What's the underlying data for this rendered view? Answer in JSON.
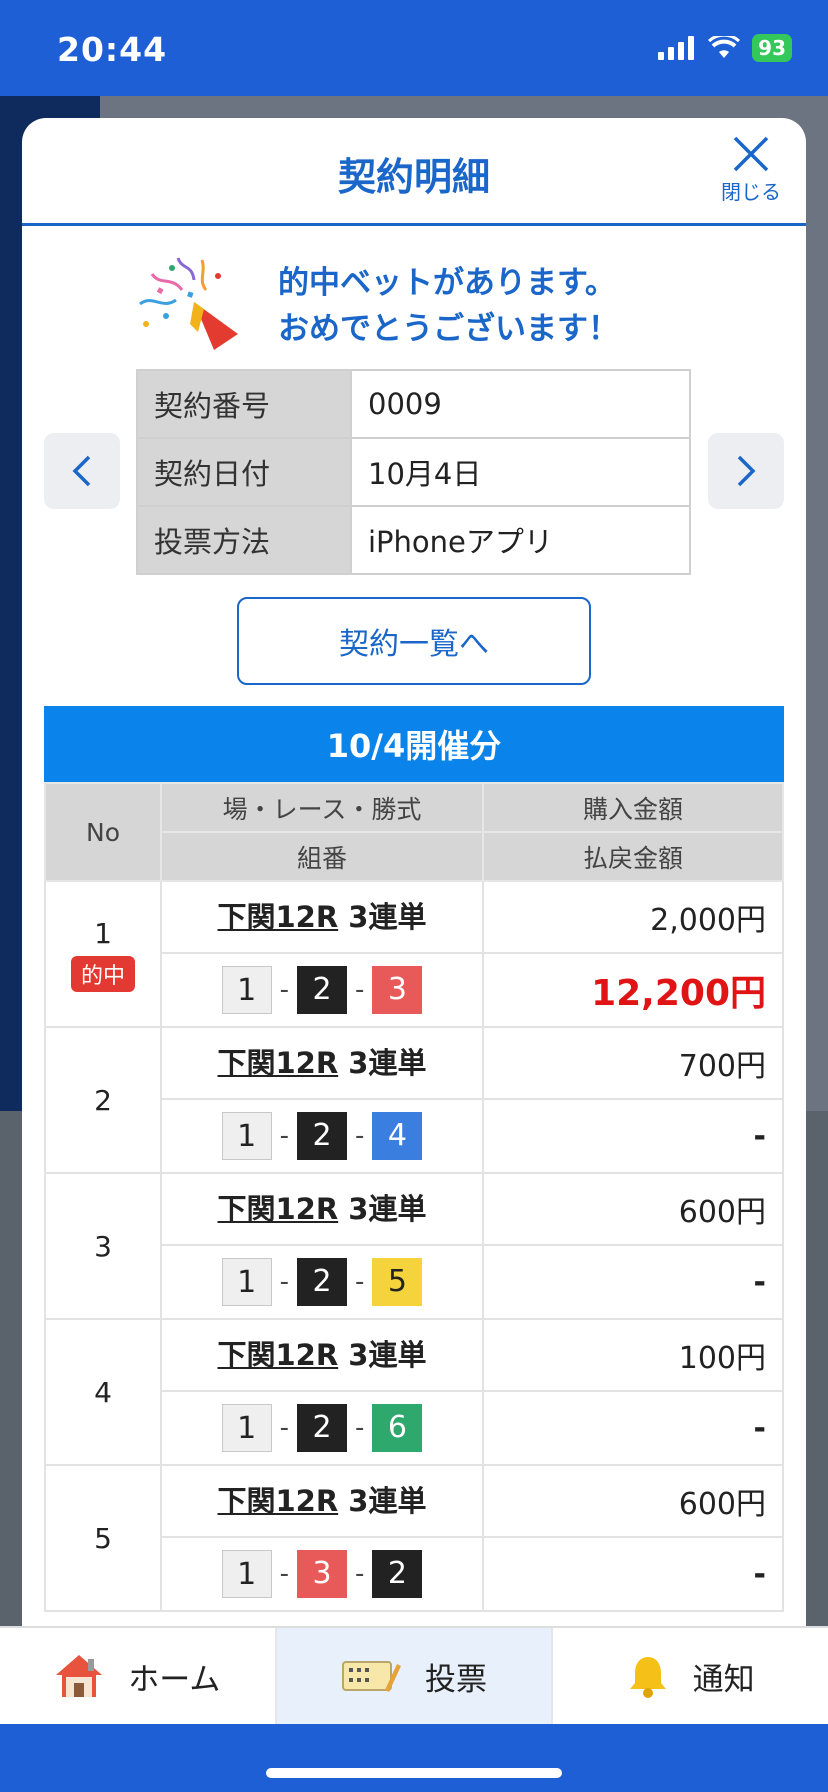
{
  "status": {
    "time": "20:44",
    "battery": "93"
  },
  "modal": {
    "title": "契約明細",
    "close_label": "閉じる",
    "congrats_line1": "的中ベットがあります。",
    "congrats_line2": "おめでとうございます！",
    "info": [
      {
        "label": "契約番号",
        "value": "0009"
      },
      {
        "label": "契約日付",
        "value": "10月4日"
      },
      {
        "label": "投票方法",
        "value": "iPhoneアプリ"
      }
    ],
    "list_button": "契約一覧へ",
    "session_title": "10/4開催分",
    "table_headers": {
      "no": "No",
      "race": "場・レース・勝式",
      "combo": "組番",
      "purchase": "購入金額",
      "payout": "払戻金額"
    },
    "bets": [
      {
        "no": "1",
        "badge": "的中",
        "place": "下関12R",
        "type": "3連単",
        "c1": "1",
        "c2": "2",
        "c3": "3",
        "purchase": "2,000円",
        "payout": "12,200円"
      },
      {
        "no": "2",
        "place": "下関12R",
        "type": "3連単",
        "c1": "1",
        "c2": "2",
        "c3": "4",
        "purchase": "700円",
        "payout": "-"
      },
      {
        "no": "3",
        "place": "下関12R",
        "type": "3連単",
        "c1": "1",
        "c2": "2",
        "c3": "5",
        "purchase": "600円",
        "payout": "-"
      },
      {
        "no": "4",
        "place": "下関12R",
        "type": "3連単",
        "c1": "1",
        "c2": "2",
        "c3": "6",
        "purchase": "100円",
        "payout": "-"
      },
      {
        "no": "5",
        "place": "下関12R",
        "type": "3連単",
        "c1": "1",
        "c2": "3",
        "c3": "2",
        "purchase": "600円",
        "payout": "-"
      }
    ]
  },
  "tabbar": {
    "home": "ホーム",
    "vote": "投票",
    "notify": "通知"
  },
  "colors": {
    "accent": "#1a66c9",
    "header_blue": "#0a84ea",
    "win_red": "#e01414",
    "status_blue": "#1e5fd6"
  },
  "icons": {
    "close": "close-icon",
    "prev": "chevron-left-icon",
    "next": "chevron-right-icon",
    "party": "party-popper-icon",
    "home": "house-icon",
    "vote": "ticket-pen-icon",
    "notify": "bell-icon"
  }
}
